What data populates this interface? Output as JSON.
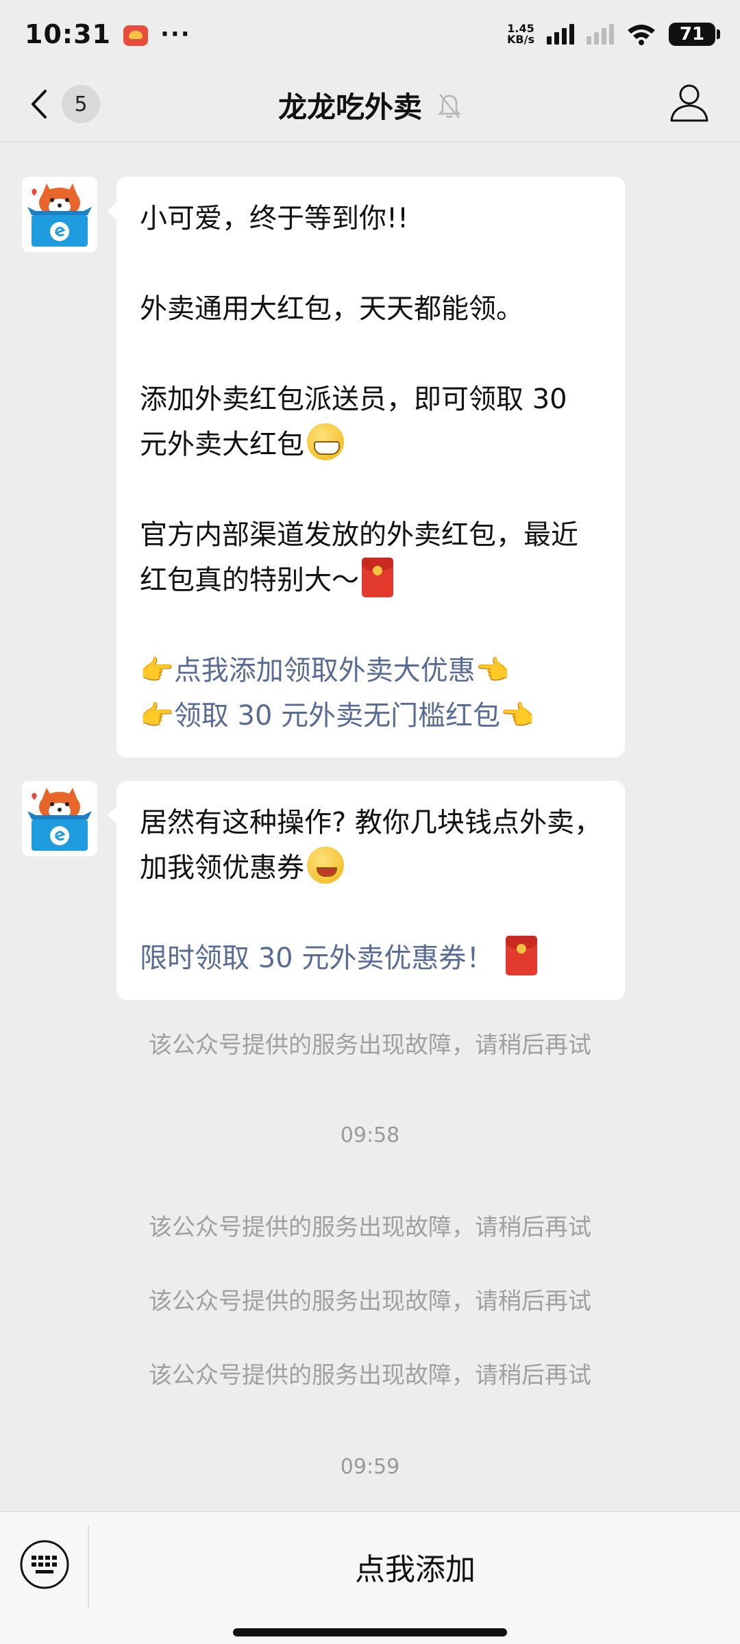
{
  "status_bar": {
    "time": "10:31",
    "more": "···",
    "net_speed_value": "1.45",
    "net_speed_unit": "KB/s",
    "battery": "71"
  },
  "nav": {
    "unread_count": "5",
    "title": "龙龙吃外卖"
  },
  "messages": [
    {
      "paragraphs": [
        "小可爱，终于等到你!!",
        "外卖通用大红包，天天都能领。",
        "添加外卖红包派送员，即可领取 30 元外卖大红包",
        "官方内部渠道发放的外卖红包，最近红包真的特别大～"
      ],
      "links": [
        "点我添加领取外卖大优惠",
        "领取 30 元外卖无门槛红包"
      ]
    },
    {
      "paragraphs": [
        "居然有这种操作? 教你几块钱点外卖，加我领优惠券"
      ],
      "links": [
        "限时领取 30 元外卖优惠券！"
      ]
    }
  ],
  "system_notes": [
    "该公众号提供的服务出现故障，请稍后再试",
    "09:58",
    "该公众号提供的服务出现故障，请稍后再试",
    "该公众号提供的服务出现故障，请稍后再试",
    "该公众号提供的服务出现故障，请稍后再试",
    "09:59"
  ],
  "bottom_bar": {
    "menu_label": "点我添加"
  },
  "colors": {
    "link": "#576b95",
    "background": "#ededed",
    "bubble": "#ffffff",
    "system_text": "#a0a0a0"
  },
  "icons": [
    "back-icon",
    "mute-bell-icon",
    "profile-icon",
    "keyboard-icon",
    "red-packet-icon",
    "pointing-hand-icon",
    "grin-emoji-icon",
    "wink-emoji-icon"
  ]
}
